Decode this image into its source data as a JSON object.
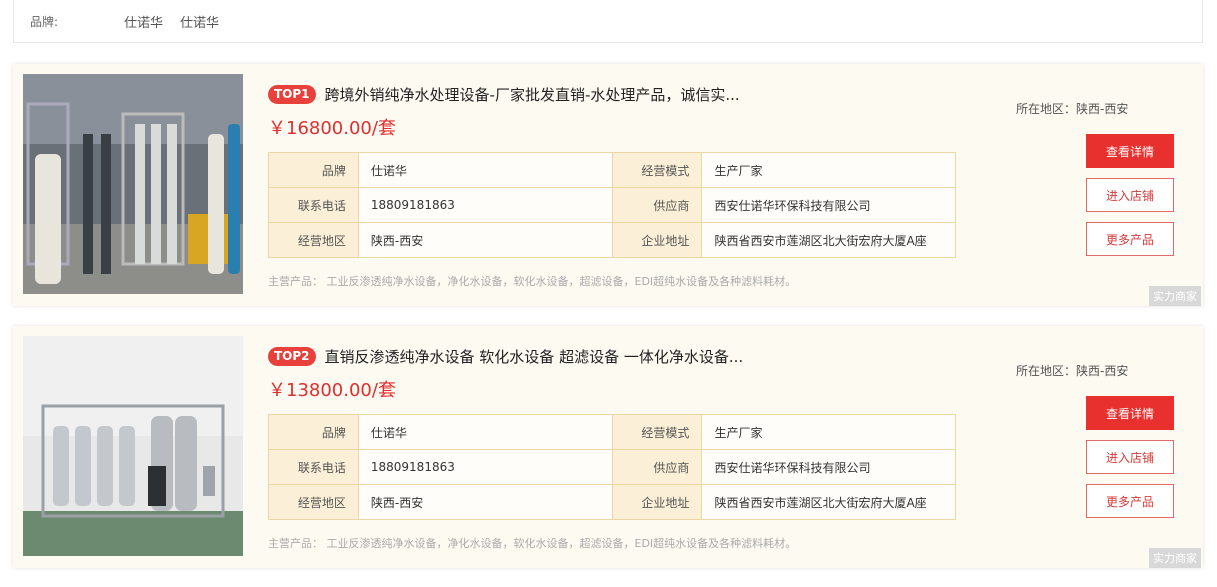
{
  "brand_filter": {
    "label": "品牌:",
    "options": [
      "仕诺华",
      "仕诺华"
    ]
  },
  "cards": [
    {
      "badge": "TOP1",
      "title": "跨境外销纯净水处理设备-厂家批发直销-水处理产品，诚信实...",
      "price": "￥16800.00/套",
      "table": [
        [
          "品牌",
          "仕诺华",
          "经营模式",
          "生产厂家"
        ],
        [
          "联系电话",
          "18809181863",
          "供应商",
          "西安仕诺华环保科技有限公司"
        ],
        [
          "经营地区",
          "陕西-西安",
          "企业地址",
          "陕西省西安市莲湖区北大街宏府大厦A座"
        ]
      ],
      "main_products_label": "主营产品：",
      "main_products": "工业反渗透纯净水设备，净化水设备，软化水设备，超滤设备，EDI超纯水设备及各种滤料耗材。",
      "region": "所在地区：陕西-西安",
      "btn_detail": "查看详情",
      "btn_shop": "进入店铺",
      "btn_more": "更多产品",
      "tag": "实力商家"
    },
    {
      "badge": "TOP2",
      "title": "直销反渗透纯净水设备 软化水设备 超滤设备 一体化净水设备...",
      "price": "￥13800.00/套",
      "table": [
        [
          "品牌",
          "仕诺华",
          "经营模式",
          "生产厂家"
        ],
        [
          "联系电话",
          "18809181863",
          "供应商",
          "西安仕诺华环保科技有限公司"
        ],
        [
          "经营地区",
          "陕西-西安",
          "企业地址",
          "陕西省西安市莲湖区北大街宏府大厦A座"
        ]
      ],
      "main_products_label": "主营产品：",
      "main_products": "工业反渗透纯净水设备，净化水设备，软化水设备，超滤设备，EDI超纯水设备及各种滤料耗材。",
      "region": "所在地区：陕西-西安",
      "btn_detail": "查看详情",
      "btn_shop": "进入店铺",
      "btn_more": "更多产品",
      "tag": "实力商家"
    }
  ]
}
